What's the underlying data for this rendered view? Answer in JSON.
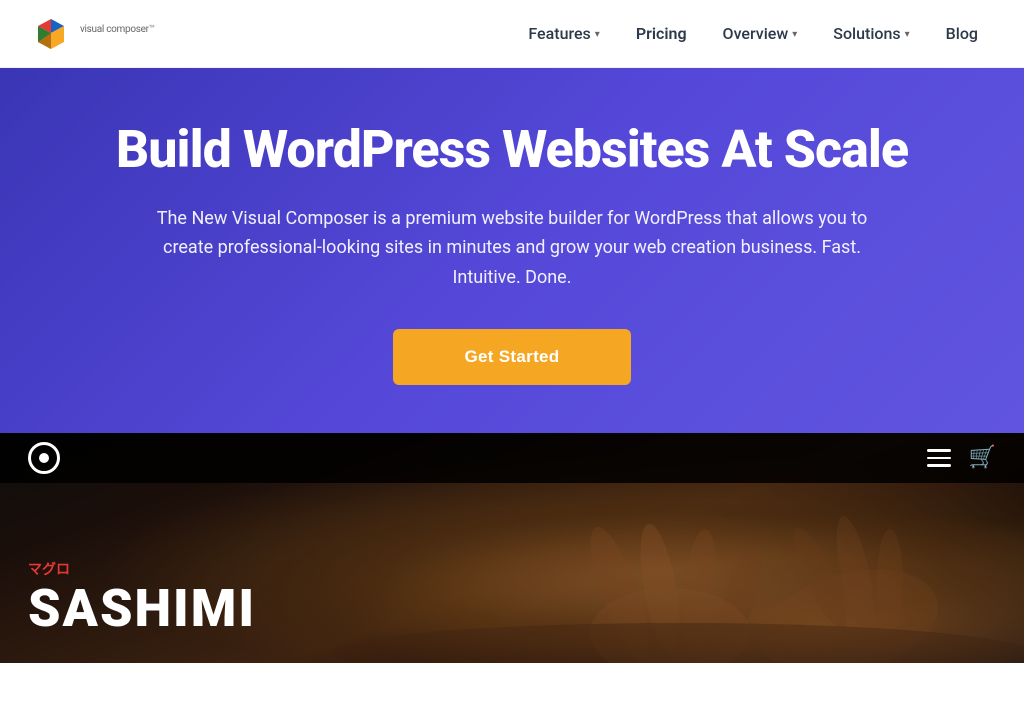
{
  "header": {
    "logo": {
      "text": "visual composer",
      "trademark": "™"
    },
    "nav": {
      "items": [
        {
          "id": "features",
          "label": "Features",
          "hasDropdown": true
        },
        {
          "id": "pricing",
          "label": "Pricing",
          "hasDropdown": false
        },
        {
          "id": "overview",
          "label": "Overview",
          "hasDropdown": true
        },
        {
          "id": "solutions",
          "label": "Solutions",
          "hasDropdown": true
        },
        {
          "id": "blog",
          "label": "Blog",
          "hasDropdown": false
        }
      ]
    }
  },
  "hero": {
    "title": "Build WordPress Websites At Scale",
    "subtitle": "The New Visual Composer is a premium website builder for WordPress that allows you to create professional-looking sites in minutes and grow your web creation business. Fast. Intuitive. Done.",
    "cta_label": "Get Started"
  },
  "preview": {
    "label": "マグロ",
    "title": "SASHIMI",
    "icons": {
      "hamburger": "hamburger-icon",
      "cart": "🛒"
    }
  },
  "colors": {
    "hero_bg": "#4545cc",
    "hero_text": "#ffffff",
    "cta_bg": "#f5a623",
    "cta_text": "#ffffff",
    "nav_text": "#2d3a4a",
    "preview_bg": "#1a1a1a",
    "preview_label": "#e53935"
  }
}
